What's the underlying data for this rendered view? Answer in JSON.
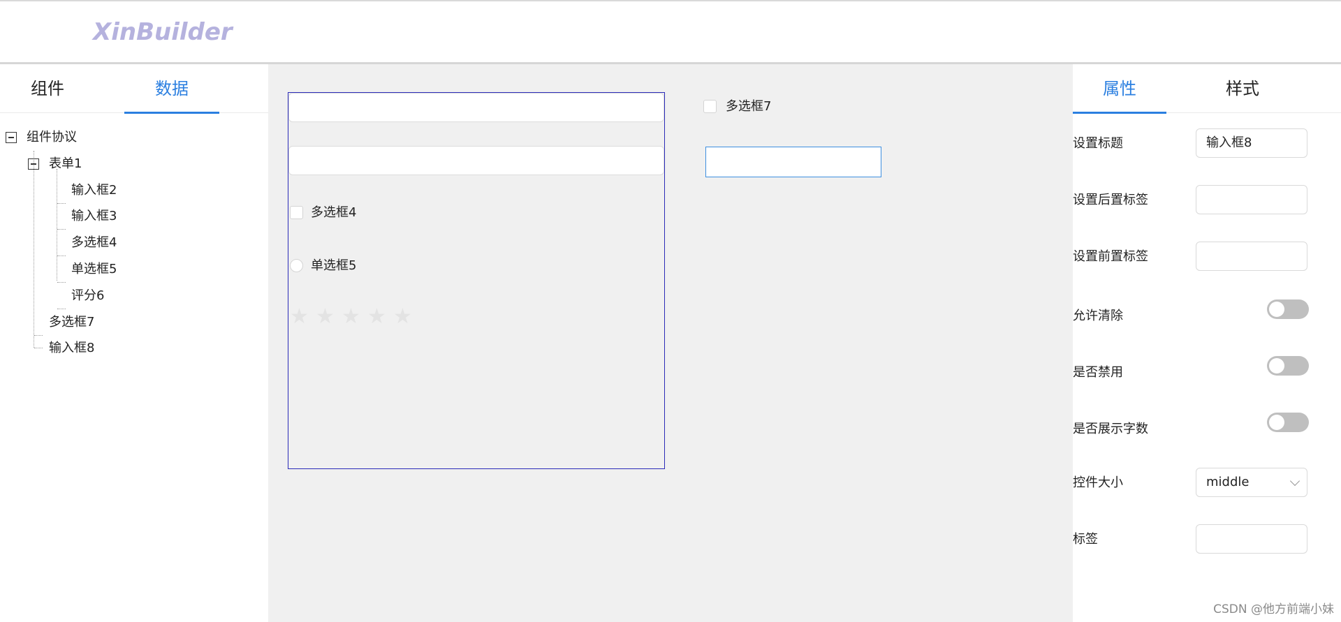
{
  "app": {
    "logo": "XinBuilder"
  },
  "left_panel": {
    "tabs": [
      {
        "label": "组件"
      },
      {
        "label": "数据"
      }
    ],
    "tree": {
      "root": "组件协议",
      "form": "表单1",
      "form_children": [
        "输入框2",
        "输入框3",
        "多选框4",
        "单选框5",
        "评分6"
      ],
      "siblings": [
        "多选框7",
        "输入框8"
      ]
    }
  },
  "canvas": {
    "checkbox4_label": "多选框4",
    "radio5_label": "单选框5",
    "rating_stars": 5,
    "rating_value": 0,
    "checkbox7_label": "多选框7"
  },
  "right_panel": {
    "tabs": [
      {
        "label": "属性"
      },
      {
        "label": "样式"
      }
    ],
    "props": {
      "title_label": "设置标题",
      "title_value": "输入框8",
      "suffix_label": "设置后置标签",
      "suffix_value": "",
      "prefix_label": "设置前置标签",
      "prefix_value": "",
      "allow_clear_label": "允许清除",
      "disabled_label": "是否禁用",
      "show_count_label": "是否展示字数",
      "size_label": "控件大小",
      "size_value": "middle",
      "tag_label": "标签",
      "tag_value": ""
    }
  },
  "watermark": "CSDN @他方前端小妹"
}
